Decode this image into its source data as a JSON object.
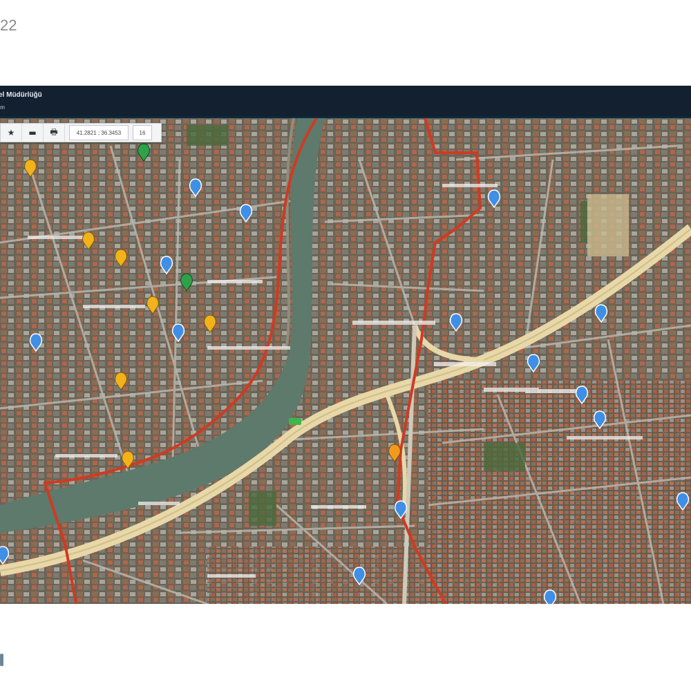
{
  "page": {
    "number": "22"
  },
  "header": {
    "title": "el Müdürlüğü",
    "subtitle": "ım"
  },
  "toolbar": {
    "star_icon": "★",
    "minus_icon": "▬",
    "print_icon": "🖶",
    "coordinates": "41.2821 ; 36.3453",
    "zoom": "16"
  },
  "map": {
    "basemap": "satellite",
    "route_color": "#d03a22",
    "highway_color": "#e8d8a8",
    "river_color": "#5d7a6c",
    "pin_colors": {
      "blue": "#3f8fe6",
      "yellow": "#f2b21c",
      "green": "#2fa14a",
      "orange": "#f29a1c"
    }
  }
}
